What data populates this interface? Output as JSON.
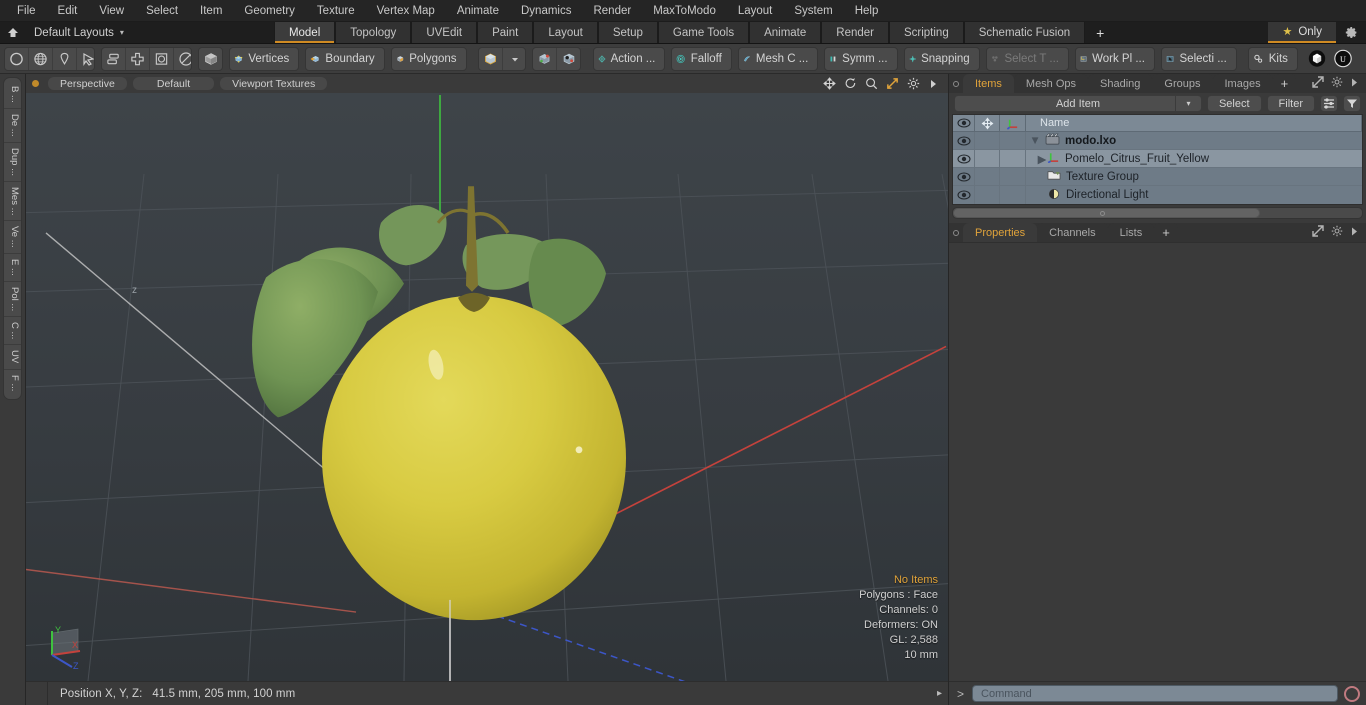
{
  "app": {
    "title": "modo",
    "accent": "#d08b23",
    "panel_bg": "#3a3a3a"
  },
  "menubar": {
    "items": [
      {
        "label": "File"
      },
      {
        "label": "Edit"
      },
      {
        "label": "View"
      },
      {
        "label": "Select"
      },
      {
        "label": "Item"
      },
      {
        "label": "Geometry"
      },
      {
        "label": "Texture"
      },
      {
        "label": "Vertex Map"
      },
      {
        "label": "Animate"
      },
      {
        "label": "Dynamics"
      },
      {
        "label": "Render"
      },
      {
        "label": "MaxToModo"
      },
      {
        "label": "Layout"
      },
      {
        "label": "System"
      },
      {
        "label": "Help"
      }
    ]
  },
  "layoutbar": {
    "home_icon": "home-icon",
    "layouts_label": "Default Layouts",
    "caret": "▾",
    "tabs": [
      {
        "label": "Model",
        "active": true
      },
      {
        "label": "Topology",
        "active": false
      },
      {
        "label": "UVEdit",
        "active": false
      },
      {
        "label": "Paint",
        "active": false
      },
      {
        "label": "Layout",
        "active": false
      },
      {
        "label": "Setup",
        "active": false
      },
      {
        "label": "Game Tools",
        "active": false
      },
      {
        "label": "Animate",
        "active": false
      },
      {
        "label": "Render",
        "active": false
      },
      {
        "label": "Scripting",
        "active": false
      },
      {
        "label": "Schematic Fusion",
        "active": false
      }
    ],
    "add_tab": "+",
    "only_button": {
      "label": "Only",
      "star": "★"
    },
    "settings_icon": "gear-icon"
  },
  "toolbar": {
    "groups": [
      {
        "name": "selection-modes",
        "buttons": [
          {
            "icon": "circle-icon",
            "label": ""
          },
          {
            "icon": "globe-icon",
            "label": ""
          },
          {
            "icon": "lasso-icon",
            "label": ""
          },
          {
            "icon": "paint-select-icon",
            "label": ""
          }
        ]
      },
      {
        "name": "element-modes",
        "buttons": [
          {
            "icon": "stack-icon",
            "label": ""
          },
          {
            "icon": "cross-icon",
            "label": ""
          },
          {
            "icon": "square-circle-icon",
            "label": ""
          },
          {
            "icon": "circle-slash-icon",
            "label": ""
          }
        ]
      },
      {
        "name": "item-mode",
        "buttons": [
          {
            "icon": "cube-icon",
            "label": ""
          }
        ]
      },
      {
        "name": "vertices-mode",
        "buttons": [
          {
            "icon": "vertices-cube-icon",
            "label": "Vertices"
          }
        ]
      },
      {
        "name": "boundary-mode",
        "buttons": [
          {
            "icon": "boundary-cube-icon",
            "label": "Boundary"
          }
        ]
      },
      {
        "name": "polygons-mode",
        "buttons": [
          {
            "icon": "polygons-cube-icon",
            "label": "Polygons"
          }
        ]
      },
      {
        "name": "cube-dropdown",
        "buttons": [
          {
            "icon": "gold-cube-icon",
            "label": ""
          },
          {
            "icon": "chevron-down-icon",
            "label": ""
          }
        ]
      },
      {
        "name": "snap-cubes",
        "buttons": [
          {
            "icon": "cube-snap-a-icon",
            "label": ""
          },
          {
            "icon": "cube-snap-b-icon",
            "label": ""
          }
        ]
      },
      {
        "name": "action-center",
        "buttons": [
          {
            "icon": "action-center-icon",
            "label": "Action   ..."
          }
        ]
      },
      {
        "name": "falloff",
        "buttons": [
          {
            "icon": "falloff-icon",
            "label": "Falloff"
          }
        ]
      },
      {
        "name": "mesh-constraint",
        "buttons": [
          {
            "icon": "mesh-constraint-icon",
            "label": "Mesh C ..."
          }
        ]
      },
      {
        "name": "symmetry",
        "buttons": [
          {
            "icon": "symmetry-icon",
            "label": "Symm ..."
          }
        ]
      },
      {
        "name": "snapping",
        "buttons": [
          {
            "icon": "snapping-icon",
            "label": "Snapping"
          }
        ]
      },
      {
        "name": "select-through",
        "buttons": [
          {
            "icon": "select-through-icon",
            "label": "Select T ...",
            "disabled": true
          }
        ]
      },
      {
        "name": "work-plane",
        "buttons": [
          {
            "icon": "work-plane-icon",
            "label": "Work Pl ..."
          }
        ]
      },
      {
        "name": "selection-sets",
        "buttons": [
          {
            "icon": "selection-arrow-icon",
            "label": "Selecti  ..."
          }
        ]
      },
      {
        "name": "kits",
        "buttons": [
          {
            "icon": "kits-gears-icon",
            "label": "Kits"
          }
        ]
      },
      {
        "name": "engine-links",
        "buttons": [
          {
            "icon": "unity-cube-icon",
            "label": ""
          },
          {
            "icon": "unreal-icon",
            "label": ""
          }
        ]
      }
    ]
  },
  "left_sidebar": {
    "tabs": [
      {
        "label": "B ..."
      },
      {
        "label": "De ..."
      },
      {
        "label": "Dup ..."
      },
      {
        "label": "Mes ..."
      },
      {
        "label": "Ve ..."
      },
      {
        "label": "E ..."
      },
      {
        "label": "Pol ..."
      },
      {
        "label": "C ..."
      },
      {
        "label": "UV"
      },
      {
        "label": "F ..."
      }
    ]
  },
  "viewport": {
    "header": {
      "view_mode": "Perspective",
      "shading_preset": "Default",
      "display_mode": "Viewport Textures",
      "tools": [
        {
          "icon": "move-view-icon"
        },
        {
          "icon": "rotate-view-icon"
        },
        {
          "icon": "zoom-view-icon"
        },
        {
          "icon": "fit-view-icon"
        },
        {
          "icon": "viewport-gear-icon"
        },
        {
          "icon": "chevron-right-icon"
        }
      ]
    },
    "status": {
      "items": "No Items",
      "polygons": "Polygons : Face",
      "channels": "Channels: 0",
      "deformers": "Deformers: ON",
      "gl": "GL: 2,588",
      "scale": "10 mm"
    },
    "axis_gizmo": {
      "x": "X",
      "y": "Y",
      "z": "Z"
    },
    "model": {
      "name": "Pomelo Citrus Fruit Yellow",
      "body_color": "#d4c43c",
      "leaf_color": "#6e9153",
      "stem_color": "#7e7431"
    }
  },
  "statusbar": {
    "position_label": "Position X, Y, Z:",
    "position_value": "41.5 mm, 205 mm, 100 mm",
    "arrow": "▸"
  },
  "right_panel": {
    "top_tabs": [
      {
        "label": "Items",
        "active": true
      },
      {
        "label": "Mesh Ops",
        "active": false
      },
      {
        "label": "Shading",
        "active": false
      },
      {
        "label": "Groups",
        "active": false
      },
      {
        "label": "Images",
        "active": false
      }
    ],
    "top_tabs_add": "+",
    "top_tabs_icons": [
      {
        "icon": "expand-icon"
      },
      {
        "icon": "gear-icon"
      },
      {
        "icon": "chevron-right-icon"
      }
    ],
    "items_toolbar": {
      "add_item": "Add Item",
      "add_item_caret": "▾",
      "select": "Select",
      "filter": "Filter",
      "list_icon": "list-options-icon",
      "funnel_icon": "funnel-icon"
    },
    "tree": {
      "columns": [
        {
          "icon": "eye-icon",
          "label": ""
        },
        {
          "icon": "lock-move-icon",
          "label": ""
        },
        {
          "icon": "axis-icon",
          "label": ""
        },
        {
          "icon": "",
          "label": "Name"
        }
      ],
      "rows": [
        {
          "name": "modo.lxo",
          "icon": "scene-clapper-icon",
          "depth": 0,
          "expander": "▼",
          "bold": true,
          "selected": false,
          "eye": true
        },
        {
          "name": "Pomelo_Citrus_Fruit_Yellow",
          "icon": "mesh-axis-icon",
          "depth": 1,
          "expander": "▶",
          "bold": false,
          "selected": true,
          "eye": true
        },
        {
          "name": "Texture Group",
          "icon": "texture-group-icon",
          "depth": 1,
          "expander": "",
          "bold": false,
          "selected": false,
          "eye": true
        },
        {
          "name": "Directional Light",
          "icon": "light-icon",
          "depth": 1,
          "expander": "",
          "bold": false,
          "selected": false,
          "eye": true
        }
      ]
    },
    "bottom_tabs": [
      {
        "label": "Properties",
        "active": true
      },
      {
        "label": "Channels",
        "active": false
      },
      {
        "label": "Lists",
        "active": false
      }
    ],
    "bottom_tabs_add": "+",
    "command": {
      "prompt": ">",
      "placeholder": "Command",
      "record_icon": "record-circle-icon"
    }
  }
}
